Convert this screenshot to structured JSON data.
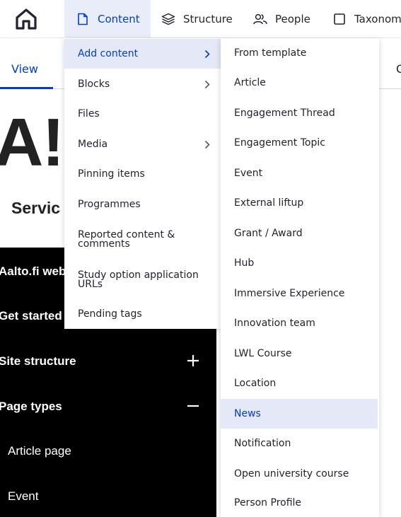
{
  "toolbar": {
    "items": [
      {
        "label": "Content"
      },
      {
        "label": "Structure"
      },
      {
        "label": "People"
      },
      {
        "label": "Taxonomy"
      }
    ]
  },
  "page": {
    "tabs": [
      {
        "label": "View"
      }
    ],
    "edge_tab_fragment": "C",
    "title_fragment": "A!",
    "subtitle_fragment": "Servic"
  },
  "side_nav": {
    "items": [
      {
        "label": "Aalto.fi web"
      },
      {
        "label": "Get started"
      },
      {
        "label": "Site structure",
        "toggle": "+"
      },
      {
        "label": "Page types",
        "toggle": "−"
      }
    ],
    "sub_items": [
      {
        "label": "Article page"
      },
      {
        "label": "Event"
      }
    ]
  },
  "content_menu": {
    "items": [
      {
        "label": "Add content",
        "has_submenu": true,
        "active": true
      },
      {
        "label": "Blocks",
        "has_submenu": true
      },
      {
        "label": "Files"
      },
      {
        "label": "Media",
        "has_submenu": true
      },
      {
        "label": "Pinning items"
      },
      {
        "label": "Programmes"
      },
      {
        "label": "Reported content & comments"
      },
      {
        "label": "Study option application URLs"
      },
      {
        "label": "Pending tags"
      }
    ]
  },
  "add_content_menu": {
    "selected": "News",
    "items": [
      {
        "label": "From template"
      },
      {
        "label": "Article"
      },
      {
        "label": "Engagement Thread"
      },
      {
        "label": "Engagement Topic"
      },
      {
        "label": "Event"
      },
      {
        "label": "External liftup"
      },
      {
        "label": "Grant / Award"
      },
      {
        "label": "Hub"
      },
      {
        "label": "Immersive Experience"
      },
      {
        "label": "Innovation team"
      },
      {
        "label": "LWL Course"
      },
      {
        "label": "Location"
      },
      {
        "label": "News"
      },
      {
        "label": "Notification"
      },
      {
        "label": "Open university course"
      },
      {
        "label": "Person Profile"
      }
    ]
  },
  "colors": {
    "accent": "#003ecc",
    "active_bg": "#e4e8f7",
    "text": "#222330",
    "nav_bg": "#000000"
  },
  "icons": {
    "home": "home-icon",
    "content": "document-icon",
    "structure": "layers-icon",
    "people": "people-icon",
    "taxonomy": "square-icon",
    "submenu": "chevron-right-icon",
    "expand": "plus-icon",
    "collapse": "minus-icon"
  }
}
